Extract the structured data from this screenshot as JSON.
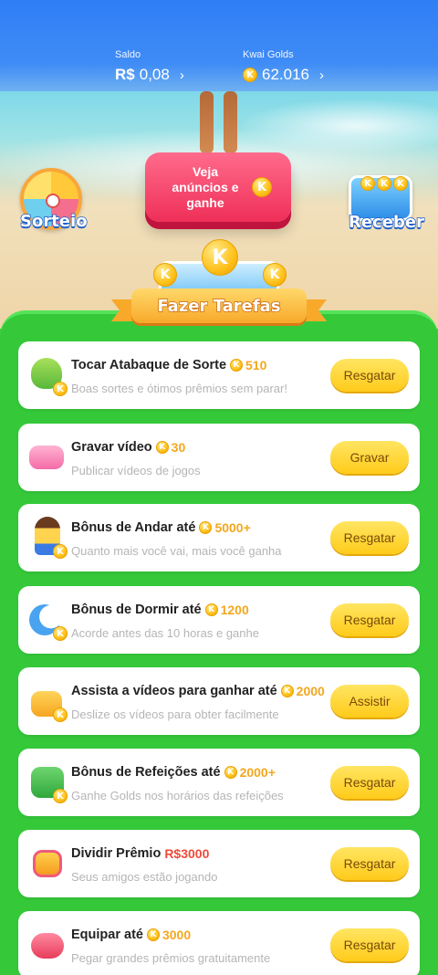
{
  "header": {
    "saldo": {
      "label": "Saldo",
      "currency": "R$",
      "value": "0,08",
      "chevron": "›"
    },
    "golds": {
      "label": "Kwai Golds",
      "value": "62.016",
      "chevron": "›"
    }
  },
  "scene": {
    "watch_ads_label": "Veja anúncios e ganhe",
    "sorteio_label": "Sorteio",
    "receber_label": "Receber"
  },
  "banner": {
    "title": "Fazer Tarefas",
    "coin_letter": "K"
  },
  "tasks": [
    {
      "title": "Tocar Atabaque de Sorte",
      "reward": "510",
      "reward_type": "coin",
      "desc": "Boas sortes e ótimos prêmios sem parar!",
      "button": "Resgatar",
      "icon": "drum-icon"
    },
    {
      "title": "Gravar vídeo",
      "reward": "30",
      "reward_type": "coin",
      "desc": "Publicar vídeos de jogos",
      "button": "Gravar",
      "icon": "video-record-icon"
    },
    {
      "title": "Bônus de Andar até",
      "reward": "5000+",
      "reward_type": "coin",
      "desc": "Quanto mais você vai, mais você ganha",
      "button": "Resgatar",
      "icon": "walking-person-icon"
    },
    {
      "title": "Bônus de Dormir até",
      "reward": "1200",
      "reward_type": "coin",
      "desc": "Acorde antes das 10 horas e ganhe",
      "button": "Resgatar",
      "icon": "moon-icon"
    },
    {
      "title": "Assista a vídeos para ganhar até",
      "reward": "2000",
      "reward_type": "coin",
      "desc": "Deslize os vídeos para obter facilmente",
      "button": "Assistir",
      "icon": "camera-icon"
    },
    {
      "title": "Bônus de Refeições até",
      "reward": "2000+",
      "reward_type": "coin",
      "desc": "Ganhe Golds nos horários das refeições",
      "button": "Resgatar",
      "icon": "calendar-icon"
    },
    {
      "title": "Dividir Prêmio",
      "reward": "R$3000",
      "reward_type": "cash",
      "desc": "Seus amigos estão jogando",
      "button": "Resgatar",
      "icon": "gift-icon"
    },
    {
      "title": "Equipar até",
      "reward": "3000",
      "reward_type": "coin",
      "desc": "Pegar grandes prêmios gratuitamente",
      "button": "Resgatar",
      "icon": "boxing-glove-icon"
    }
  ],
  "colors": {
    "header_blue": "#2f7ef5",
    "panel_green": "#35c93a",
    "coin_gold": "#ffc11a",
    "button_yellow": "#ffd52e",
    "red_accent": "#ef2f58"
  }
}
